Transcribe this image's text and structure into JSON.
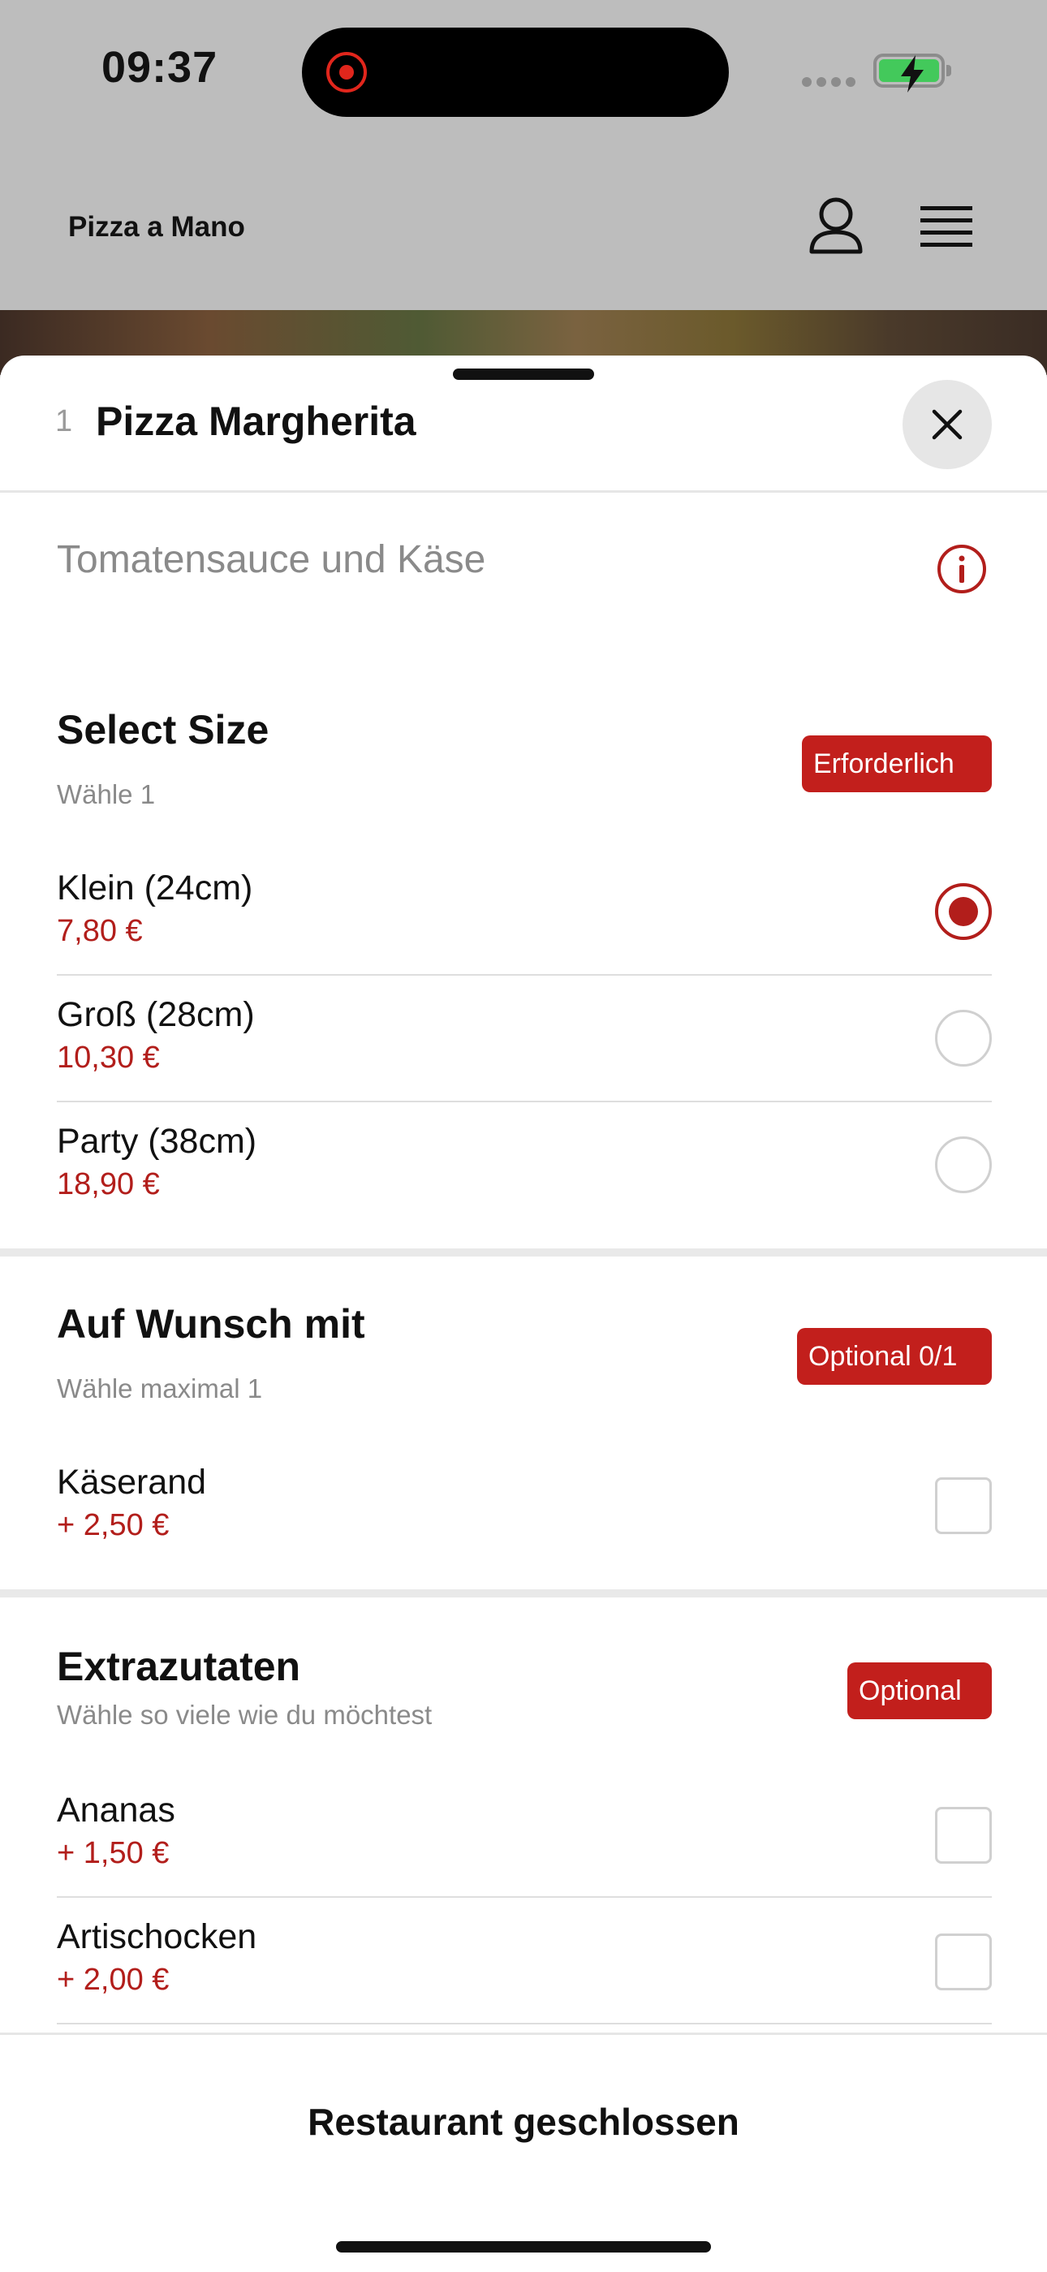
{
  "status_bar": {
    "time": "09:37"
  },
  "header": {
    "brand": "Pizza a Mano",
    "icons": [
      "user-icon",
      "menu-icon"
    ]
  },
  "product": {
    "quantity": "1",
    "title": "Pizza Margherita",
    "description": "Tomatensauce und Käse"
  },
  "sections": {
    "size": {
      "title": "Select Size",
      "subtitle": "Wähle 1",
      "badge": "Erforderlich",
      "options": [
        {
          "name": "Klein (24cm)",
          "price": "7,80 €",
          "selected": true
        },
        {
          "name": "Groß (28cm)",
          "price": "10,30 €",
          "selected": false
        },
        {
          "name": "Party (38cm)",
          "price": "18,90 €",
          "selected": false
        }
      ]
    },
    "wunsch": {
      "title": "Auf Wunsch mit",
      "subtitle": "Wähle maximal 1",
      "badge": "Optional 0/1",
      "options": [
        {
          "name": "Käserand",
          "price": "+ 2,50 €",
          "checked": false
        }
      ]
    },
    "extras": {
      "title": "Extrazutaten",
      "subtitle": "Wähle so viele wie du möchtest",
      "badge": "Optional",
      "options": [
        {
          "name": "Ananas",
          "price": "+ 1,50 €",
          "checked": false
        },
        {
          "name": "Artischocken",
          "price": "+ 2,00 €",
          "checked": false
        }
      ]
    }
  },
  "footer": {
    "status": "Restaurant geschlossen"
  },
  "colors": {
    "accent": "#c21f1c",
    "price": "#b21e1b",
    "battery": "#43c95b",
    "overlay": "#bdbdbd"
  }
}
